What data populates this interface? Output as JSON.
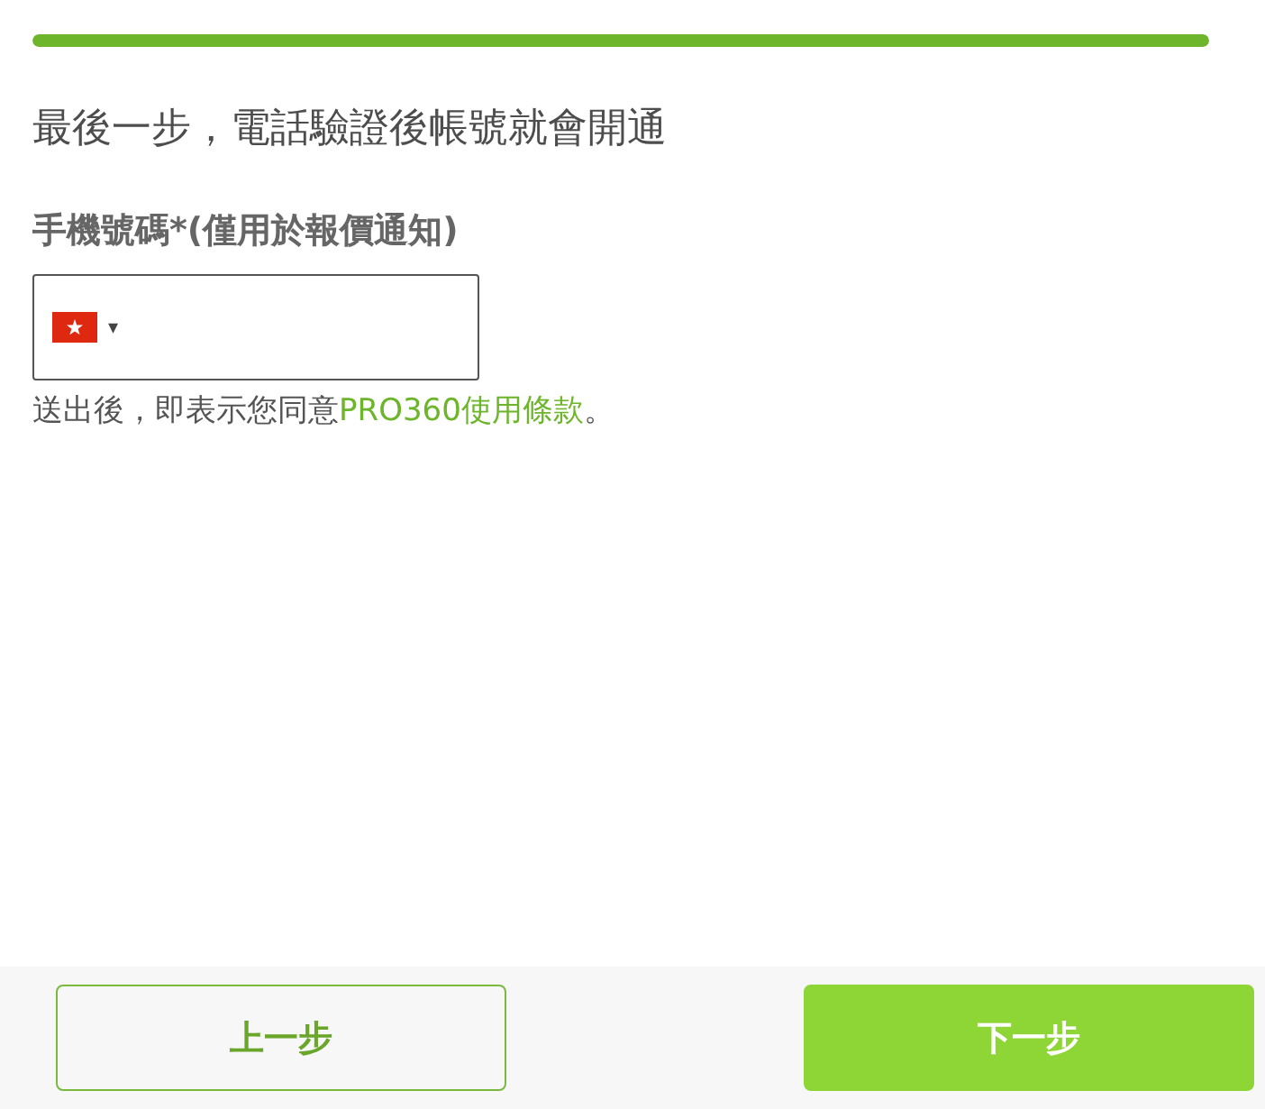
{
  "progress": {
    "level": 1
  },
  "heading": "最後一步，電話驗證後帳號就會開通",
  "phone": {
    "label": "手機號碼*(僅用於報價通知)",
    "caret": "▾"
  },
  "terms": {
    "prefix": "送出後，即表示您同意",
    "link": "PRO360使用條款",
    "suffix": "。"
  },
  "buttons": [
    {
      "label": "上一步",
      "kind": "secondary"
    },
    {
      "label": "下一步",
      "kind": "primary"
    }
  ]
}
